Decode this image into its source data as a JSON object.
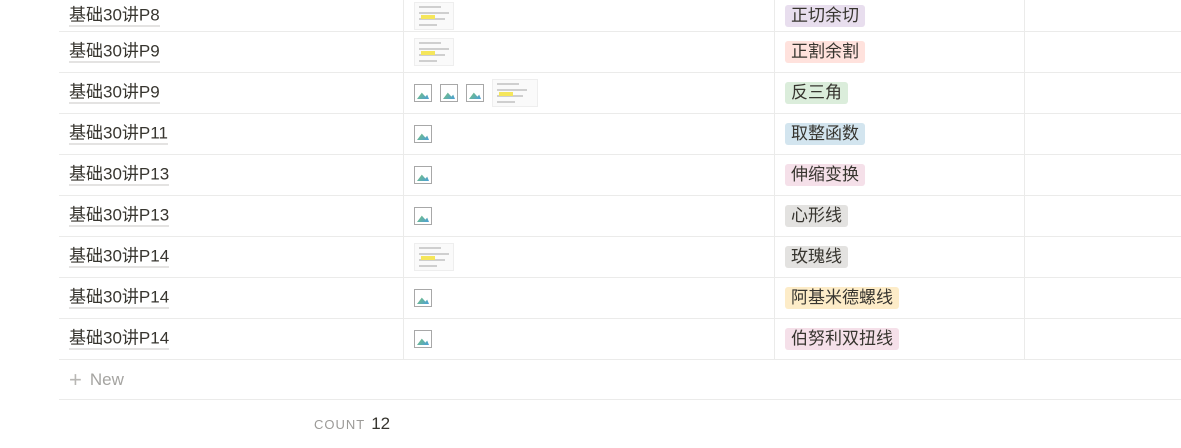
{
  "rows": [
    {
      "title": "基础30讲P8",
      "files": [
        "thumb"
      ],
      "tag": "正切余切",
      "tag_color": "#e8deee"
    },
    {
      "title": "基础30讲P9",
      "files": [
        "thumb"
      ],
      "tag": "正割余割",
      "tag_color": "#ffe2dd"
    },
    {
      "title": "基础30讲P9",
      "files": [
        "broken",
        "broken",
        "broken",
        "thumb"
      ],
      "tag": "反三角",
      "tag_color": "#dbeddb"
    },
    {
      "title": "基础30讲P11",
      "files": [
        "broken"
      ],
      "tag": "取整函数",
      "tag_color": "#d3e5ef"
    },
    {
      "title": "基础30讲P13",
      "files": [
        "broken"
      ],
      "tag": "伸缩变换",
      "tag_color": "#f5e0e9"
    },
    {
      "title": "基础30讲P13",
      "files": [
        "broken"
      ],
      "tag": "心形线",
      "tag_color": "#e3e2e0"
    },
    {
      "title": "基础30讲P14",
      "files": [
        "thumb"
      ],
      "tag": "玫瑰线",
      "tag_color": "#e3e2e0"
    },
    {
      "title": "基础30讲P14",
      "files": [
        "broken"
      ],
      "tag": "阿基米德螺线",
      "tag_color": "#fdecc8"
    },
    {
      "title": "基础30讲P14",
      "files": [
        "broken"
      ],
      "tag": "伯努利双扭线",
      "tag_color": "#f5e0e9"
    }
  ],
  "new_row_label": "New",
  "footer": {
    "count_label": "COUNT",
    "count_value": "12"
  }
}
